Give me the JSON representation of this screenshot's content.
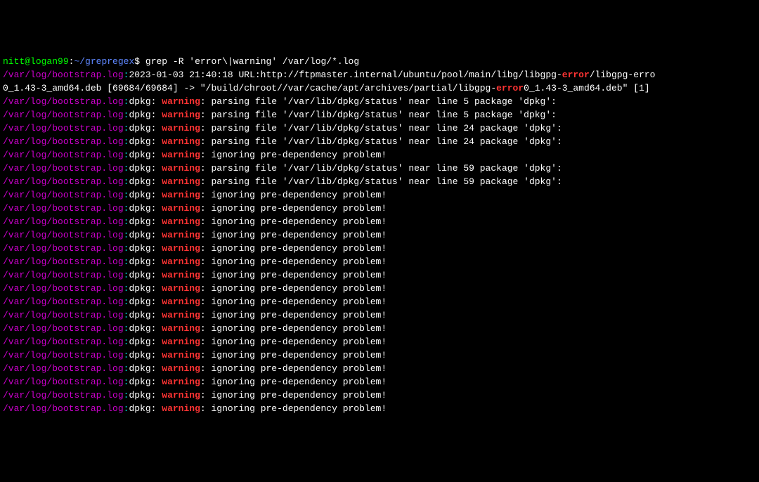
{
  "prompt": {
    "user": "nitt",
    "at": "@",
    "host": "logan99",
    "colon": ":",
    "path": "~/grepregex",
    "dollar": "$ ",
    "command": "grep -R 'error\\|warning' /var/log/*.log"
  },
  "lines": [
    {
      "segments": [
        {
          "cls": "filepath",
          "text": "/var/log/bootstrap.log"
        },
        {
          "cls": "sep-colon",
          "text": ":"
        },
        {
          "cls": "normal",
          "text": "2023-01-03 21:40:18 URL:http://ftpmaster.internal/ubuntu/pool/main/libg/libgpg-"
        },
        {
          "cls": "match",
          "text": "error"
        },
        {
          "cls": "normal",
          "text": "/libgpg-erro"
        }
      ]
    },
    {
      "segments": [
        {
          "cls": "normal",
          "text": "0_1.43-3_amd64.deb [69684/69684] -> \"/build/chroot//var/cache/apt/archives/partial/libgpg-"
        },
        {
          "cls": "match",
          "text": "error"
        },
        {
          "cls": "normal",
          "text": "0_1.43-3_amd64.deb\" [1]"
        }
      ]
    },
    {
      "segments": [
        {
          "cls": "filepath",
          "text": "/var/log/bootstrap.log"
        },
        {
          "cls": "sep-colon",
          "text": ":"
        },
        {
          "cls": "normal",
          "text": "dpkg: "
        },
        {
          "cls": "match",
          "text": "warning"
        },
        {
          "cls": "normal",
          "text": ": parsing file '/var/lib/dpkg/status' near line 5 package 'dpkg':"
        }
      ]
    },
    {
      "segments": [
        {
          "cls": "filepath",
          "text": "/var/log/bootstrap.log"
        },
        {
          "cls": "sep-colon",
          "text": ":"
        },
        {
          "cls": "normal",
          "text": "dpkg: "
        },
        {
          "cls": "match",
          "text": "warning"
        },
        {
          "cls": "normal",
          "text": ": parsing file '/var/lib/dpkg/status' near line 5 package 'dpkg':"
        }
      ]
    },
    {
      "segments": [
        {
          "cls": "filepath",
          "text": "/var/log/bootstrap.log"
        },
        {
          "cls": "sep-colon",
          "text": ":"
        },
        {
          "cls": "normal",
          "text": "dpkg: "
        },
        {
          "cls": "match",
          "text": "warning"
        },
        {
          "cls": "normal",
          "text": ": parsing file '/var/lib/dpkg/status' near line 24 package 'dpkg':"
        }
      ]
    },
    {
      "segments": [
        {
          "cls": "filepath",
          "text": "/var/log/bootstrap.log"
        },
        {
          "cls": "sep-colon",
          "text": ":"
        },
        {
          "cls": "normal",
          "text": "dpkg: "
        },
        {
          "cls": "match",
          "text": "warning"
        },
        {
          "cls": "normal",
          "text": ": parsing file '/var/lib/dpkg/status' near line 24 package 'dpkg':"
        }
      ]
    },
    {
      "segments": [
        {
          "cls": "filepath",
          "text": "/var/log/bootstrap.log"
        },
        {
          "cls": "sep-colon",
          "text": ":"
        },
        {
          "cls": "normal",
          "text": "dpkg: "
        },
        {
          "cls": "match",
          "text": "warning"
        },
        {
          "cls": "normal",
          "text": ": ignoring pre-dependency problem!"
        }
      ]
    },
    {
      "segments": [
        {
          "cls": "filepath",
          "text": "/var/log/bootstrap.log"
        },
        {
          "cls": "sep-colon",
          "text": ":"
        },
        {
          "cls": "normal",
          "text": "dpkg: "
        },
        {
          "cls": "match",
          "text": "warning"
        },
        {
          "cls": "normal",
          "text": ": parsing file '/var/lib/dpkg/status' near line 59 package 'dpkg':"
        }
      ]
    },
    {
      "segments": [
        {
          "cls": "filepath",
          "text": "/var/log/bootstrap.log"
        },
        {
          "cls": "sep-colon",
          "text": ":"
        },
        {
          "cls": "normal",
          "text": "dpkg: "
        },
        {
          "cls": "match",
          "text": "warning"
        },
        {
          "cls": "normal",
          "text": ": parsing file '/var/lib/dpkg/status' near line 59 package 'dpkg':"
        }
      ]
    },
    {
      "segments": [
        {
          "cls": "filepath",
          "text": "/var/log/bootstrap.log"
        },
        {
          "cls": "sep-colon",
          "text": ":"
        },
        {
          "cls": "normal",
          "text": "dpkg: "
        },
        {
          "cls": "match",
          "text": "warning"
        },
        {
          "cls": "normal",
          "text": ": ignoring pre-dependency problem!"
        }
      ]
    },
    {
      "segments": [
        {
          "cls": "filepath",
          "text": "/var/log/bootstrap.log"
        },
        {
          "cls": "sep-colon",
          "text": ":"
        },
        {
          "cls": "normal",
          "text": "dpkg: "
        },
        {
          "cls": "match",
          "text": "warning"
        },
        {
          "cls": "normal",
          "text": ": ignoring pre-dependency problem!"
        }
      ]
    },
    {
      "segments": [
        {
          "cls": "filepath",
          "text": "/var/log/bootstrap.log"
        },
        {
          "cls": "sep-colon",
          "text": ":"
        },
        {
          "cls": "normal",
          "text": "dpkg: "
        },
        {
          "cls": "match",
          "text": "warning"
        },
        {
          "cls": "normal",
          "text": ": ignoring pre-dependency problem!"
        }
      ]
    },
    {
      "segments": [
        {
          "cls": "filepath",
          "text": "/var/log/bootstrap.log"
        },
        {
          "cls": "sep-colon",
          "text": ":"
        },
        {
          "cls": "normal",
          "text": "dpkg: "
        },
        {
          "cls": "match",
          "text": "warning"
        },
        {
          "cls": "normal",
          "text": ": ignoring pre-dependency problem!"
        }
      ]
    },
    {
      "segments": [
        {
          "cls": "filepath",
          "text": "/var/log/bootstrap.log"
        },
        {
          "cls": "sep-colon",
          "text": ":"
        },
        {
          "cls": "normal",
          "text": "dpkg: "
        },
        {
          "cls": "match",
          "text": "warning"
        },
        {
          "cls": "normal",
          "text": ": ignoring pre-dependency problem!"
        }
      ]
    },
    {
      "segments": [
        {
          "cls": "filepath",
          "text": "/var/log/bootstrap.log"
        },
        {
          "cls": "sep-colon",
          "text": ":"
        },
        {
          "cls": "normal",
          "text": "dpkg: "
        },
        {
          "cls": "match",
          "text": "warning"
        },
        {
          "cls": "normal",
          "text": ": ignoring pre-dependency problem!"
        }
      ]
    },
    {
      "segments": [
        {
          "cls": "filepath",
          "text": "/var/log/bootstrap.log"
        },
        {
          "cls": "sep-colon",
          "text": ":"
        },
        {
          "cls": "normal",
          "text": "dpkg: "
        },
        {
          "cls": "match",
          "text": "warning"
        },
        {
          "cls": "normal",
          "text": ": ignoring pre-dependency problem!"
        }
      ]
    },
    {
      "segments": [
        {
          "cls": "filepath",
          "text": "/var/log/bootstrap.log"
        },
        {
          "cls": "sep-colon",
          "text": ":"
        },
        {
          "cls": "normal",
          "text": "dpkg: "
        },
        {
          "cls": "match",
          "text": "warning"
        },
        {
          "cls": "normal",
          "text": ": ignoring pre-dependency problem!"
        }
      ]
    },
    {
      "segments": [
        {
          "cls": "filepath",
          "text": "/var/log/bootstrap.log"
        },
        {
          "cls": "sep-colon",
          "text": ":"
        },
        {
          "cls": "normal",
          "text": "dpkg: "
        },
        {
          "cls": "match",
          "text": "warning"
        },
        {
          "cls": "normal",
          "text": ": ignoring pre-dependency problem!"
        }
      ]
    },
    {
      "segments": [
        {
          "cls": "filepath",
          "text": "/var/log/bootstrap.log"
        },
        {
          "cls": "sep-colon",
          "text": ":"
        },
        {
          "cls": "normal",
          "text": "dpkg: "
        },
        {
          "cls": "match",
          "text": "warning"
        },
        {
          "cls": "normal",
          "text": ": ignoring pre-dependency problem!"
        }
      ]
    },
    {
      "segments": [
        {
          "cls": "filepath",
          "text": "/var/log/bootstrap.log"
        },
        {
          "cls": "sep-colon",
          "text": ":"
        },
        {
          "cls": "normal",
          "text": "dpkg: "
        },
        {
          "cls": "match",
          "text": "warning"
        },
        {
          "cls": "normal",
          "text": ": ignoring pre-dependency problem!"
        }
      ]
    },
    {
      "segments": [
        {
          "cls": "filepath",
          "text": "/var/log/bootstrap.log"
        },
        {
          "cls": "sep-colon",
          "text": ":"
        },
        {
          "cls": "normal",
          "text": "dpkg: "
        },
        {
          "cls": "match",
          "text": "warning"
        },
        {
          "cls": "normal",
          "text": ": ignoring pre-dependency problem!"
        }
      ]
    },
    {
      "segments": [
        {
          "cls": "filepath",
          "text": "/var/log/bootstrap.log"
        },
        {
          "cls": "sep-colon",
          "text": ":"
        },
        {
          "cls": "normal",
          "text": "dpkg: "
        },
        {
          "cls": "match",
          "text": "warning"
        },
        {
          "cls": "normal",
          "text": ": ignoring pre-dependency problem!"
        }
      ]
    },
    {
      "segments": [
        {
          "cls": "filepath",
          "text": "/var/log/bootstrap.log"
        },
        {
          "cls": "sep-colon",
          "text": ":"
        },
        {
          "cls": "normal",
          "text": "dpkg: "
        },
        {
          "cls": "match",
          "text": "warning"
        },
        {
          "cls": "normal",
          "text": ": ignoring pre-dependency problem!"
        }
      ]
    },
    {
      "segments": [
        {
          "cls": "filepath",
          "text": "/var/log/bootstrap.log"
        },
        {
          "cls": "sep-colon",
          "text": ":"
        },
        {
          "cls": "normal",
          "text": "dpkg: "
        },
        {
          "cls": "match",
          "text": "warning"
        },
        {
          "cls": "normal",
          "text": ": ignoring pre-dependency problem!"
        }
      ]
    },
    {
      "segments": [
        {
          "cls": "filepath",
          "text": "/var/log/bootstrap.log"
        },
        {
          "cls": "sep-colon",
          "text": ":"
        },
        {
          "cls": "normal",
          "text": "dpkg: "
        },
        {
          "cls": "match",
          "text": "warning"
        },
        {
          "cls": "normal",
          "text": ": ignoring pre-dependency problem!"
        }
      ]
    },
    {
      "segments": [
        {
          "cls": "filepath",
          "text": "/var/log/bootstrap.log"
        },
        {
          "cls": "sep-colon",
          "text": ":"
        },
        {
          "cls": "normal",
          "text": "dpkg: "
        },
        {
          "cls": "match",
          "text": "warning"
        },
        {
          "cls": "normal",
          "text": ": ignoring pre-dependency problem!"
        }
      ]
    }
  ]
}
